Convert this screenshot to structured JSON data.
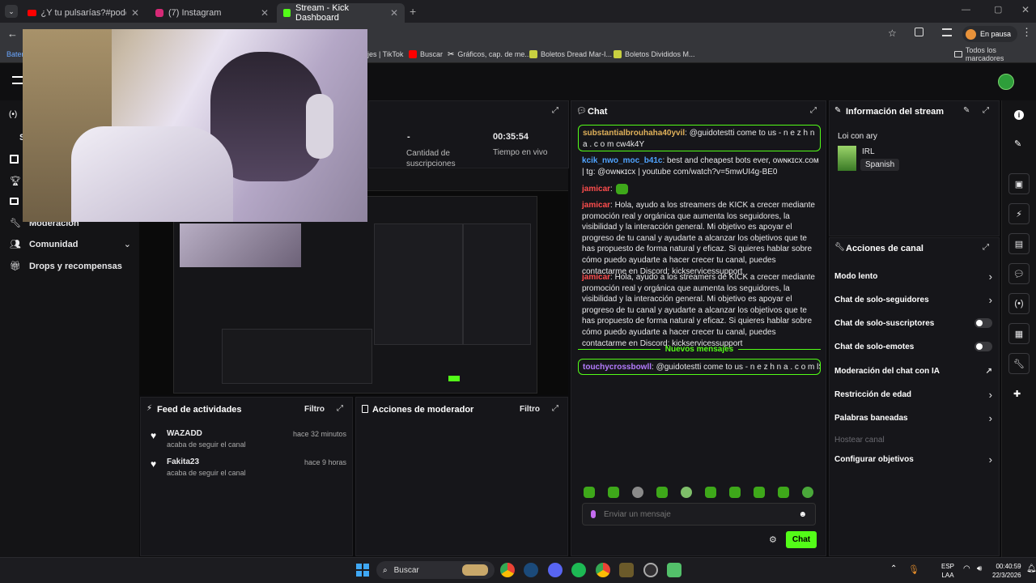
{
  "browser": {
    "tabs": [
      {
        "title": "¿Y tu pulsarías?#podcast #clip"
      },
      {
        "title": "(7) Instagram"
      },
      {
        "title": "Stream - Kick Dashboard"
      }
    ],
    "profile_label": "En pausa",
    "bookmarks": [
      {
        "label": "Bater"
      },
      {
        "label": "jes | TikTok"
      },
      {
        "label": "Buscar"
      },
      {
        "label": "Gráficos, cap. de me..."
      },
      {
        "label": "Boletos Dread Mar-I..."
      },
      {
        "label": "Boletos Divididos M..."
      },
      {
        "label": "Todos los marcadores"
      }
    ]
  },
  "sidebar": {
    "partial_label": "S",
    "items": [
      {
        "label": "Moderación"
      },
      {
        "label": "Comunidad"
      },
      {
        "label": "Drops y recompensas"
      }
    ]
  },
  "stats": {
    "subs_value": "-",
    "subs_label": "Cantidad de suscripciones",
    "time_value": "00:35:54",
    "time_label": "Tiempo en vivo"
  },
  "chat": {
    "title": "Chat",
    "messages": [
      {
        "user": "substantialbrouhaha40yvil",
        "text": ": @guidotestti come to us - n e z h n a . c o m cw4k4Y",
        "user_color": "#e0b15a",
        "highlight": true
      },
      {
        "user": "kcik_nwo_moc_b41c",
        "text": ": best and cheapest bots ever, ᴏᴡɴᴋɪᴄx.ᴄᴏᴍ | tg: @ᴏᴡɴᴋɪᴄx | youtube com/watch?v=5mwUI4g-BE0",
        "user_color": "#4fa3ff",
        "highlight": false
      },
      {
        "user": "jamicar",
        "text": ":",
        "user_color": "#ff4d4d",
        "highlight": false,
        "emote": true
      },
      {
        "user": "jamicar",
        "text": ": Hola, ayudo a los streamers de KICK a crecer mediante promoción real y orgánica que aumenta los seguidores, la visibilidad y la interacción general. Mi objetivo es apoyar el progreso de tu canal y ayudarte a alcanzar los objetivos que te has propuesto de forma natural y eficaz. Si quieres hablar sobre cómo puedo ayudarte a hacer crecer tu canal, puedes contactarme en Discord: kickservicessupport",
        "user_color": "#ff4d4d",
        "highlight": false
      },
      {
        "user": "jamicar",
        "text": ": Hola, ayudo a los streamers de KICK a crecer mediante promoción real y orgánica que aumenta los seguidores, la visibilidad y la interacción general. Mi objetivo es apoyar el progreso de tu canal y ayudarte a alcanzar los objetivos que te has propuesto de forma natural y eficaz. Si quieres hablar sobre cómo puedo ayudarte a hacer crecer tu canal, puedes contactarme en Discord: kickservicessupport",
        "user_color": "#ff4d4d",
        "highlight": false
      }
    ],
    "new_messages_label": "Nuevos mensajes",
    "new_message": {
      "user": "touchycrossbowll",
      "text": ": @guidotestti come to us - n e z h n a . c o m lSExw",
      "user_color": "#b57cff"
    },
    "input_placeholder": "Enviar un mensaje",
    "send_label": "Chat"
  },
  "stream_info": {
    "title": "Información del stream",
    "stream_title": "Loi con ary",
    "category": "IRL",
    "language": "Spanish"
  },
  "channel_actions": {
    "title": "Acciones de canal",
    "items": [
      {
        "label": "Modo lento",
        "control": "chevron"
      },
      {
        "label": "Chat de solo-seguidores",
        "control": "chevron"
      },
      {
        "label": "Chat de solo-suscriptores",
        "control": "toggle"
      },
      {
        "label": "Chat de solo-emotes",
        "control": "toggle"
      },
      {
        "label": "Moderación del chat con IA",
        "control": "external"
      },
      {
        "label": "Restricción de edad",
        "control": "chevron"
      },
      {
        "label": "Palabras baneadas",
        "control": "chevron"
      },
      {
        "label": "Hostear canal",
        "control": "none",
        "disabled": true
      },
      {
        "label": "Configurar objetivos",
        "control": "chevron"
      }
    ]
  },
  "activity": {
    "title": "Feed de actividades",
    "filter_label": "Filtro",
    "items": [
      {
        "name": "WAZADD",
        "action": "acaba de seguir el canal",
        "time": "hace 32 minutos"
      },
      {
        "name": "Fakita23",
        "action": "acaba de seguir el canal",
        "time": "hace 9 horas"
      }
    ]
  },
  "mod_actions": {
    "title": "Acciones de moderador",
    "filter_label": "Filtro"
  },
  "taskbar": {
    "search_placeholder": "Buscar",
    "lang": "ESP",
    "region": "LAA",
    "time": "00:40:59",
    "date": "22/3/2026"
  },
  "colors": {
    "accent": "#53fc18",
    "background": "#0b0b0d",
    "panel": "#16161a"
  }
}
